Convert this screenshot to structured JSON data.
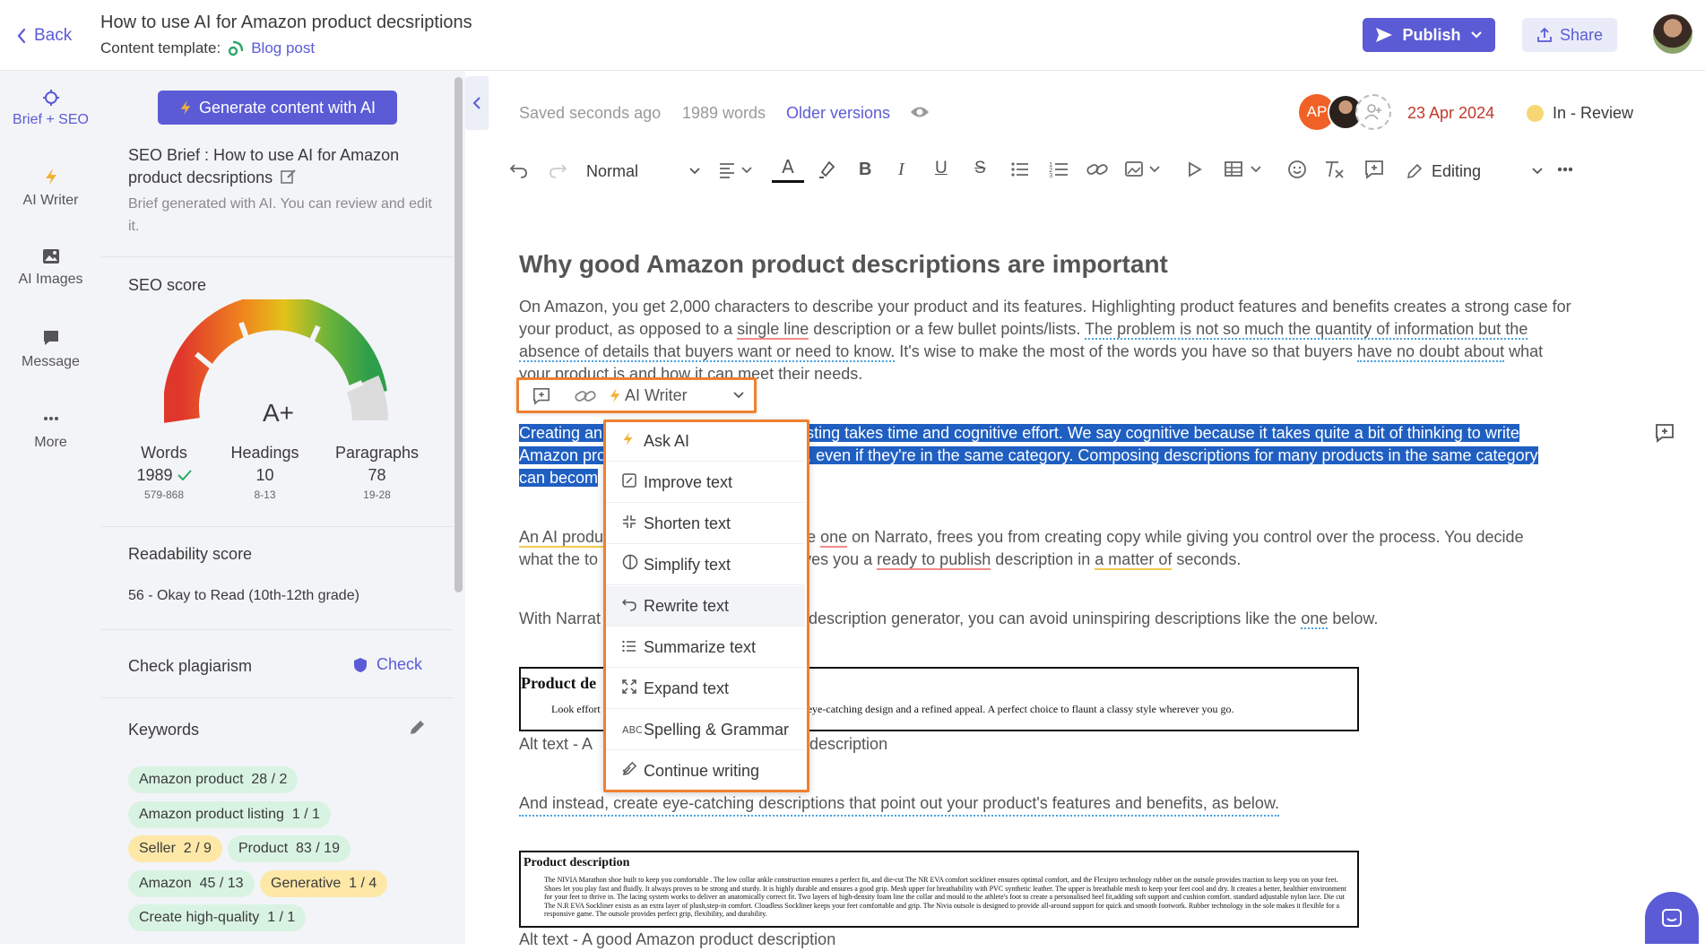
{
  "header": {
    "back_label": "Back",
    "title": "How to use AI for Amazon product decsriptions",
    "template_label": "Content template:",
    "template_name": "Blog post",
    "publish_label": "Publish",
    "share_label": "Share"
  },
  "nav": [
    {
      "label": "Brief + SEO",
      "icon": "crosshair-icon"
    },
    {
      "label": "AI Writer",
      "icon": "lightning-icon"
    },
    {
      "label": "AI Images",
      "icon": "image-icon"
    },
    {
      "label": "Message",
      "icon": "chat-icon"
    },
    {
      "label": "More",
      "icon": "dots-icon"
    }
  ],
  "brief": {
    "generate_label": "Generate content with AI",
    "seo_brief_title": "SEO Brief : How to use AI for Amazon product decsriptions",
    "brief_note": "Brief generated with AI. You can review and edit it.",
    "seo_score_label": "SEO score",
    "grade": "A+",
    "stats": [
      {
        "label": "Words",
        "value": "1989",
        "range": "579-868"
      },
      {
        "label": "Headings",
        "value": "10",
        "range": "8-13"
      },
      {
        "label": "Paragraphs",
        "value": "78",
        "range": "19-28"
      }
    ],
    "readability_label": "Readability score",
    "readability_value": "56 - Okay to Read (10th-12th grade)",
    "plagiarism_label": "Check plagiarism",
    "check_label": "Check",
    "keywords_label": "Keywords",
    "keywords": [
      {
        "text": "Amazon product",
        "count": "28 / 2",
        "status": "green"
      },
      {
        "text": "Amazon product listing",
        "count": "1 / 1",
        "status": "green"
      },
      {
        "text": "Seller",
        "count": "2 / 9",
        "status": "yellow"
      },
      {
        "text": "Product",
        "count": "83 / 19",
        "status": "green"
      },
      {
        "text": "Amazon",
        "count": "45 / 13",
        "status": "green"
      },
      {
        "text": "Generative",
        "count": "1 / 4",
        "status": "yellow"
      },
      {
        "text": "Create high-quality",
        "count": "1 / 1",
        "status": "green"
      }
    ]
  },
  "status_bar": {
    "saved": "Saved seconds ago",
    "words": "1989 words",
    "older_versions": "Older versions",
    "avatar_initials": "AP",
    "date": "23 Apr 2024",
    "review_status": "In - Review",
    "status_color": "#f7d774"
  },
  "toolbar": {
    "text_style": "Normal",
    "mode": "Editing"
  },
  "doc": {
    "heading": "Why good Amazon product descriptions are important",
    "p1_a": "On Amazon, you get 2,000 characters to describe your product and its features. Highlighting product features and benefits creates a strong case for",
    "p1_b1": "your product, as opposed to a ",
    "p1_b2": "single line",
    "p1_b3": " description or a few bullet points/lists. ",
    "p1_b4": "The problem is not so much the quantity of information but the",
    "p1_c1": "absence of details that buyers want or need to know.",
    "p1_c2": " It's wise to make the most of the words you have so that buyers ",
    "p1_c3": "have no doubt about",
    "p1_c4": " what",
    "p1_d": "your product is and how it can meet their needs.",
    "sel_a1": "Creating an",
    "sel_a2": "ct listing takes time and cognitive effort. We say cognitive because it takes quite a bit of thinking to write",
    "sel_b1": "Amazon pro",
    "sel_b2": "atch, even if they're in the same category. Composing descriptions for many products in the same category",
    "sel_c1": "can becom",
    "p3_a1": "An AI produ",
    "p3_a2": "ke the ",
    "p3_a3": "one",
    "p3_a4": " on Narrato, frees you from creating copy while giving you control over the process. You decide",
    "p3_b1": "what the to",
    "p3_b2": "AI gives you a ",
    "p3_b3": "ready to publish",
    "p3_b4": " description in ",
    "p3_b5": "a matter of",
    "p3_b6": " seconds.",
    "p4_a1": "With Narrat",
    "p4_a2": "description generator, you can avoid uninspiring descriptions like the ",
    "p4_a3": "one",
    "p4_a4": " below.",
    "img1_title": "Product de",
    "img1_text_a": "Look effort",
    "img1_text_b": "ar featuring an eye-catching design and a refined appeal. A perfect choice to flaunt a classy style wherever you go.",
    "alt1_a": "Alt text - A",
    "alt1_b": "ct description",
    "p5_a": "And instead, create eye-catching descriptions that point out your product's features and benefits, as below.",
    "img2_title": "Product description",
    "img2_text": "The NIVIA Marathon shoe built to keep you comfortable . The low collar ankle construction ensures a perfect fit, and die-cut The NR EVA comfort sockliner ensures optimal comfort, and the Flexipro technology rubber on the outsole provides traction to keep you on your feet. Shoes let you play fast and fluidly. It always proves to be strong and sturdy. It is highly durable and ensures a good grip. Mesh upper for breathability with PVC synthetic leather. The upper is breathable mesh to keep your feet cool and dry. It creates a better, healthier environment for your feet to thrive in. The lacing system works to deliver an anatomically correct fit. Two layers of high-density foam line the collar and mould to the athlete's foot to create a personalised heel fit,adding soft support and cushion comfort. standard adjustable nylon lace. Die cut The N.R EVA Sockliner exists as an extra layer of plush,step-in comfort. Cloudless Sockliner keeps your feet comfortable and grip. The Nivia outsole is designed to provide all-around support for quick and smooth footwork. Rubber technology in the sole makes it flexible for a responsive game. The outsole provides perfect grip, flexibility, and durability.",
    "alt2": "Alt text - A good Amazon product description"
  },
  "floating_toolbar": {
    "ai_writer_label": "AI Writer"
  },
  "ai_menu": [
    {
      "label": "Ask AI",
      "icon": "lightning-icon"
    },
    {
      "label": "Improve text",
      "icon": "edit-icon"
    },
    {
      "label": "Shorten text",
      "icon": "shrink-icon"
    },
    {
      "label": "Simplify text",
      "icon": "simplify-icon"
    },
    {
      "label": "Rewrite text",
      "icon": "rewrite-icon"
    },
    {
      "label": "Summarize text",
      "icon": "list-icon"
    },
    {
      "label": "Expand text",
      "icon": "expand-icon"
    },
    {
      "label": "Spelling & Grammar",
      "icon": "spellcheck-icon"
    },
    {
      "label": "Continue writing",
      "icon": "pen-icon"
    }
  ],
  "colors": {
    "accent": "#5b5bd6",
    "highlight": "#f08030",
    "selection": "#1f5fc2"
  }
}
